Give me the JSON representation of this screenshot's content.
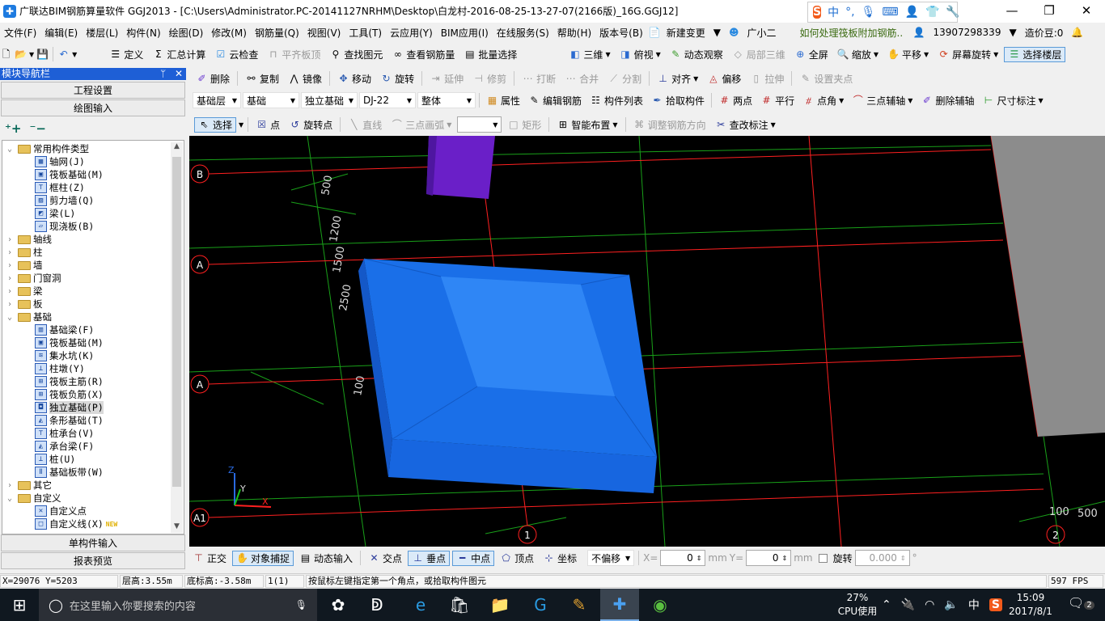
{
  "window": {
    "title": "广联达BIM钢筋算量软件 GGJ2013 - [C:\\Users\\Administrator.PC-20141127NRHM\\Desktop\\白龙村-2016-08-25-13-27-07(2166版)_16G.GGJ12]",
    "minimize": "—",
    "restore": "❐",
    "close": "✕"
  },
  "ime": {
    "lang": "中",
    "punct": "°,"
  },
  "menu": [
    "文件(F)",
    "编辑(E)",
    "楼层(L)",
    "构件(N)",
    "绘图(D)",
    "修改(M)",
    "钢筋量(Q)",
    "视图(V)",
    "工具(T)",
    "云应用(Y)",
    "BIM应用(I)",
    "在线服务(S)",
    "帮助(H)",
    "版本号(B)"
  ],
  "menu_right": {
    "new_change": "新建变更",
    "assistant": "广小二",
    "tip": "如何处理筏板附加钢筋..",
    "account": "13907298339",
    "beans": "造价豆:0"
  },
  "toolbar1": {
    "items": [
      "定义",
      "汇总计算",
      "云检查",
      "平齐板顶",
      "查找图元",
      "查看钢筋量",
      "批量选择"
    ],
    "view": [
      "三维",
      "俯视",
      "动态观察",
      "局部三维",
      "全屏",
      "缩放",
      "平移",
      "屏幕旋转",
      "选择楼层"
    ]
  },
  "toolbar2": [
    "删除",
    "复制",
    "镜像",
    "移动",
    "旋转",
    "延伸",
    "修剪",
    "打断",
    "合并",
    "分割",
    "对齐",
    "偏移",
    "拉伸",
    "设置夹点"
  ],
  "toolbar3": {
    "floor": "基础层",
    "category": "基础",
    "type": "独立基础",
    "component": "DJ-22",
    "part": "整体",
    "items": [
      "属性",
      "编辑钢筋",
      "构件列表",
      "拾取构件",
      "两点",
      "平行",
      "点角",
      "三点辅轴",
      "删除辅轴",
      "尺寸标注"
    ]
  },
  "toolbar4": {
    "items": [
      "选择",
      "点",
      "旋转点",
      "直线",
      "三点画弧",
      "矩形",
      "智能布置",
      "调整钢筋方向",
      "查改标注"
    ],
    "combo": ""
  },
  "sidebar": {
    "title": "模块导航栏",
    "pin": "ᛘ",
    "close": "✕",
    "project_settings": "工程设置",
    "drawing_input": "绘图输入",
    "single_input": "单构件输入",
    "report_preview": "报表预览",
    "tree": [
      {
        "label": "常用构件类型",
        "level": 0,
        "kind": "folder",
        "open": true
      },
      {
        "label": "轴网(J)",
        "level": 1
      },
      {
        "label": "筏板基础(M)",
        "level": 1
      },
      {
        "label": "框柱(Z)",
        "level": 1
      },
      {
        "label": "剪力墙(Q)",
        "level": 1
      },
      {
        "label": "梁(L)",
        "level": 1
      },
      {
        "label": "现浇板(B)",
        "level": 1
      },
      {
        "label": "轴线",
        "level": 0,
        "kind": "folder"
      },
      {
        "label": "柱",
        "level": 0,
        "kind": "folder"
      },
      {
        "label": "墙",
        "level": 0,
        "kind": "folder"
      },
      {
        "label": "门窗洞",
        "level": 0,
        "kind": "folder"
      },
      {
        "label": "梁",
        "level": 0,
        "kind": "folder"
      },
      {
        "label": "板",
        "level": 0,
        "kind": "folder"
      },
      {
        "label": "基础",
        "level": 0,
        "kind": "folder",
        "open": true
      },
      {
        "label": "基础梁(F)",
        "level": 1
      },
      {
        "label": "筏板基础(M)",
        "level": 1
      },
      {
        "label": "集水坑(K)",
        "level": 1
      },
      {
        "label": "柱墩(Y)",
        "level": 1
      },
      {
        "label": "筏板主筋(R)",
        "level": 1
      },
      {
        "label": "筏板负筋(X)",
        "level": 1
      },
      {
        "label": "独立基础(P)",
        "level": 1,
        "selected": true
      },
      {
        "label": "条形基础(T)",
        "level": 1
      },
      {
        "label": "桩承台(V)",
        "level": 1
      },
      {
        "label": "承台梁(F)",
        "level": 1
      },
      {
        "label": "桩(U)",
        "level": 1
      },
      {
        "label": "基础板带(W)",
        "level": 1
      },
      {
        "label": "其它",
        "level": 0,
        "kind": "folder"
      },
      {
        "label": "自定义",
        "level": 0,
        "kind": "folder",
        "open": true
      },
      {
        "label": "自定义点",
        "level": 1
      },
      {
        "label": "自定义线(X)",
        "level": 1,
        "badge": "NEW"
      }
    ]
  },
  "canvas": {
    "axis_labels": [
      "B",
      "A",
      "A",
      "A1",
      "1",
      "2"
    ],
    "dimensions": [
      "500",
      "1200",
      "1500",
      "2500",
      "100",
      "100",
      "500"
    ],
    "gizmo": {
      "z": "Z",
      "y": "Y",
      "x": "X"
    },
    "colors": {
      "footing": "#1a6fe8",
      "footing_top": "#2f86f5",
      "column": "#6a1fc8",
      "wall": "#8c8c8c",
      "grid_red": "#ff2020",
      "grid_green": "#19a019"
    }
  },
  "bottom_toolbar": {
    "items": [
      "正交",
      "对象捕捉",
      "动态输入",
      "交点",
      "垂点",
      "中点",
      "顶点",
      "坐标"
    ],
    "offset": "不偏移",
    "x_label": "X=",
    "x_value": "0",
    "y_label": "Y=",
    "y_value": "0",
    "unit": "mm",
    "rotate_label": "旋转",
    "rotate_value": "0.000",
    "deg": "°"
  },
  "statusbar": {
    "coords": "X=29076 Y=5203",
    "floor_height": "层高:3.55m",
    "bottom_elev": "底标高:-3.58m",
    "count": "1(1)",
    "hint": "按鼠标左键指定第一个角点，或拾取构件图元",
    "fps": "597 FPS"
  },
  "taskbar": {
    "search_placeholder": "在这里输入你要搜索的内容",
    "cpu": "27%",
    "cpu_label": "CPU使用",
    "ime": "中",
    "time": "15:09",
    "date": "2017/8/1",
    "notifications": "2"
  }
}
